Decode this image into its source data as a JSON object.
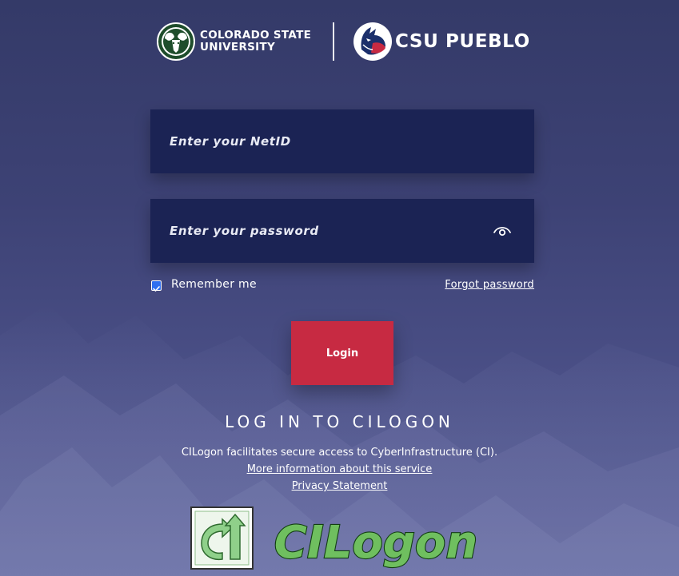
{
  "header": {
    "csu_line1": "COLORADO STATE",
    "csu_line2": "UNIVERSITY",
    "pueblo_name": "CSU PUEBLO"
  },
  "form": {
    "netid_placeholder": "Enter your NetID",
    "password_placeholder": "Enter your password",
    "remember_label": "Remember me",
    "remember_checked": true,
    "forgot_label": "Forgot password",
    "login_label": "Login"
  },
  "cilogon": {
    "heading": "LOG IN TO CILOGON",
    "description": "CILogon facilitates secure access to CyberInfrastructure (CI).",
    "more_info_link": "More information about this service",
    "privacy_link": "Privacy Statement",
    "logo_text": "CILogon"
  },
  "colors": {
    "background": "#3d4275",
    "field_bg": "#1b2354",
    "login_button": "#c72a42",
    "csu_green": "#1e4d2b",
    "cilogon_green": "#3f9a3f"
  },
  "icons": {
    "csu_logo": "ram-head-icon",
    "pueblo_logo": "wolf-head-icon",
    "password_toggle": "eye-icon",
    "cilogon_logo": "cilogon-arrow-icon"
  }
}
